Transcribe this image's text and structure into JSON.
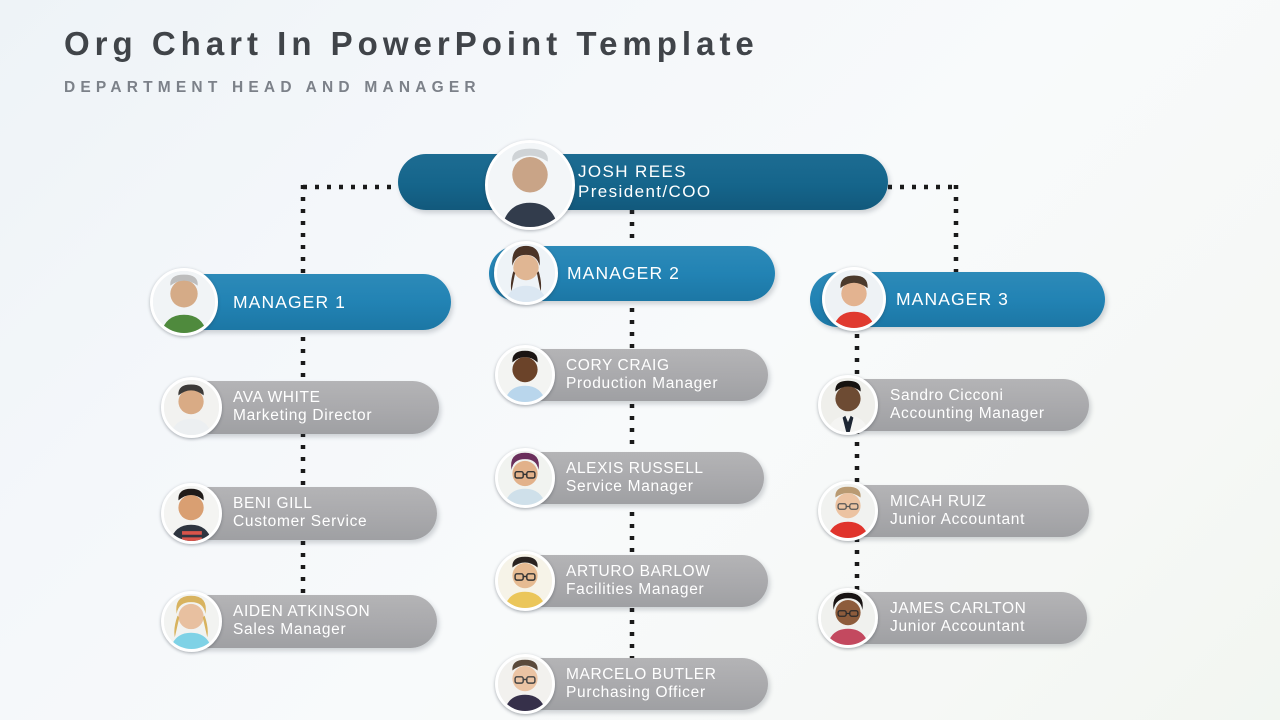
{
  "header": {
    "title": "Org Chart In PowerPoint Template",
    "subtitle": "DEPARTMENT HEAD AND MANAGER"
  },
  "colors": {
    "root_node": "#15658b",
    "manager_node": "#2283b4",
    "staff_node": "#a9a9ac",
    "node_text": "#ffffff",
    "title_text": "#404449",
    "subtitle_text": "#7c8189",
    "connector": "#1a1a1a",
    "background": "#f4f7fa"
  },
  "chart_data": {
    "type": "diagram",
    "layout": "organization-chart",
    "connector_style": "dotted",
    "root": {
      "name": "JOSH REES",
      "role": "President/COO"
    },
    "branches": [
      {
        "manager": {
          "name": "MANAGER 1",
          "role": ""
        },
        "reports": [
          {
            "name": "AVA WHITE",
            "role": "Marketing Director"
          },
          {
            "name": "BENI GILL",
            "role": "Customer Service"
          },
          {
            "name": "AIDEN ATKINSON",
            "role": "Sales Manager"
          }
        ]
      },
      {
        "manager": {
          "name": "MANAGER 2",
          "role": ""
        },
        "reports": [
          {
            "name": "CORY CRAIG",
            "role": "Production Manager"
          },
          {
            "name": "ALEXIS RUSSELL",
            "role": "Service Manager"
          },
          {
            "name": "ARTURO BARLOW",
            "role": "Facilities Manager"
          },
          {
            "name": "MARCELO BUTLER",
            "role": "Purchasing Officer"
          }
        ]
      },
      {
        "manager": {
          "name": "MANAGER 3",
          "role": ""
        },
        "reports": [
          {
            "name": "Sandro Cicconi",
            "role": "Accounting Manager"
          },
          {
            "name": "MICAH RUIZ",
            "role": "Junior Accountant"
          },
          {
            "name": "JAMES CARLTON",
            "role": "Junior Accountant"
          }
        ]
      }
    ]
  },
  "nodes": {
    "root": {
      "name": "JOSH REES",
      "role": "President/COO",
      "avatar": "avatar-josh-rees"
    },
    "manager1": {
      "name": "MANAGER 1",
      "avatar": "avatar-manager-1"
    },
    "manager2": {
      "name": "MANAGER 2",
      "avatar": "avatar-manager-2"
    },
    "manager3": {
      "name": "MANAGER 3",
      "avatar": "avatar-manager-3"
    },
    "c1r1": {
      "name": "AVA WHITE",
      "role": "Marketing Director",
      "avatar": "avatar-ava-white"
    },
    "c1r2": {
      "name": "BENI GILL",
      "role": "Customer Service",
      "avatar": "avatar-beni-gill"
    },
    "c1r3": {
      "name": "AIDEN ATKINSON",
      "role": "Sales Manager",
      "avatar": "avatar-aiden-atkinson"
    },
    "c2r1": {
      "name": "CORY CRAIG",
      "role": "Production Manager",
      "avatar": "avatar-cory-craig"
    },
    "c2r2": {
      "name": "ALEXIS RUSSELL",
      "role": "Service Manager",
      "avatar": "avatar-alexis-russell"
    },
    "c2r3": {
      "name": "ARTURO BARLOW",
      "role": "Facilities Manager",
      "avatar": "avatar-arturo-barlow"
    },
    "c2r4": {
      "name": "MARCELO BUTLER",
      "role": "Purchasing Officer",
      "avatar": "avatar-marcelo-butler"
    },
    "c3r1": {
      "name": "Sandro Cicconi",
      "role": "Accounting Manager",
      "avatar": "avatar-sandro-cicconi"
    },
    "c3r2": {
      "name": "MICAH RUIZ",
      "role": "Junior Accountant",
      "avatar": "avatar-micah-ruiz"
    },
    "c3r3": {
      "name": "JAMES CARLTON",
      "role": "Junior Accountant",
      "avatar": "avatar-james-carlton"
    }
  }
}
